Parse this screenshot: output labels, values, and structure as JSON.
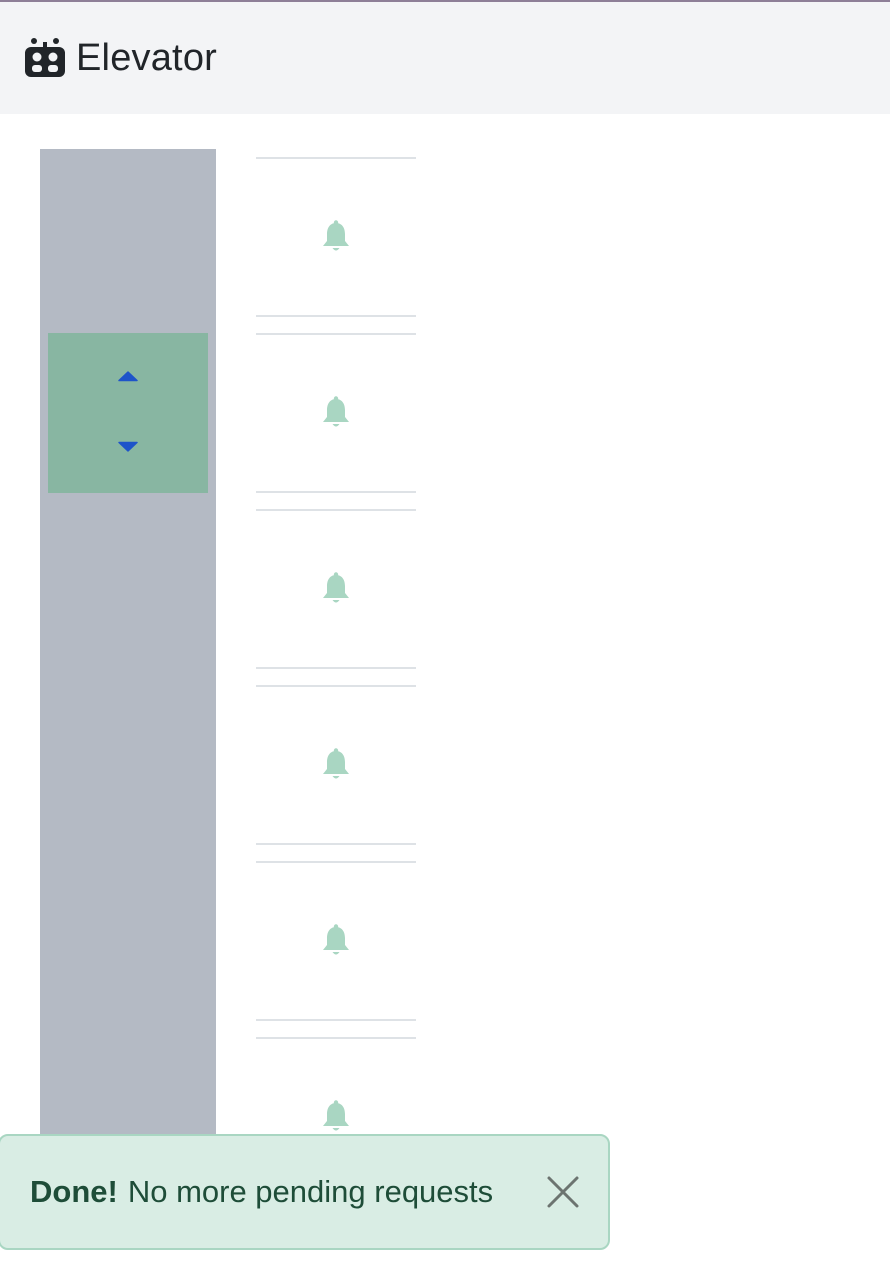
{
  "header": {
    "title": "Elevator",
    "icon": "robot-icon"
  },
  "elevator": {
    "current_floor_index": 1,
    "car_controls": {
      "up_icon": "caret-up-icon",
      "down_icon": "caret-down-icon"
    },
    "floor_count": 6,
    "floor_button_icon": "bell-icon"
  },
  "toast": {
    "strong": "Done!",
    "message": "No more pending requests",
    "close_icon": "close-icon"
  },
  "colors": {
    "header_bg": "#f3f4f6",
    "shaft": "#b4bac4",
    "car": "#88b6a2",
    "arrow": "#1e54c9",
    "bell": "#a9d6c2",
    "toast_bg": "#d9ede4",
    "toast_border": "#a9d6c2",
    "toast_text": "#1e4d38"
  }
}
